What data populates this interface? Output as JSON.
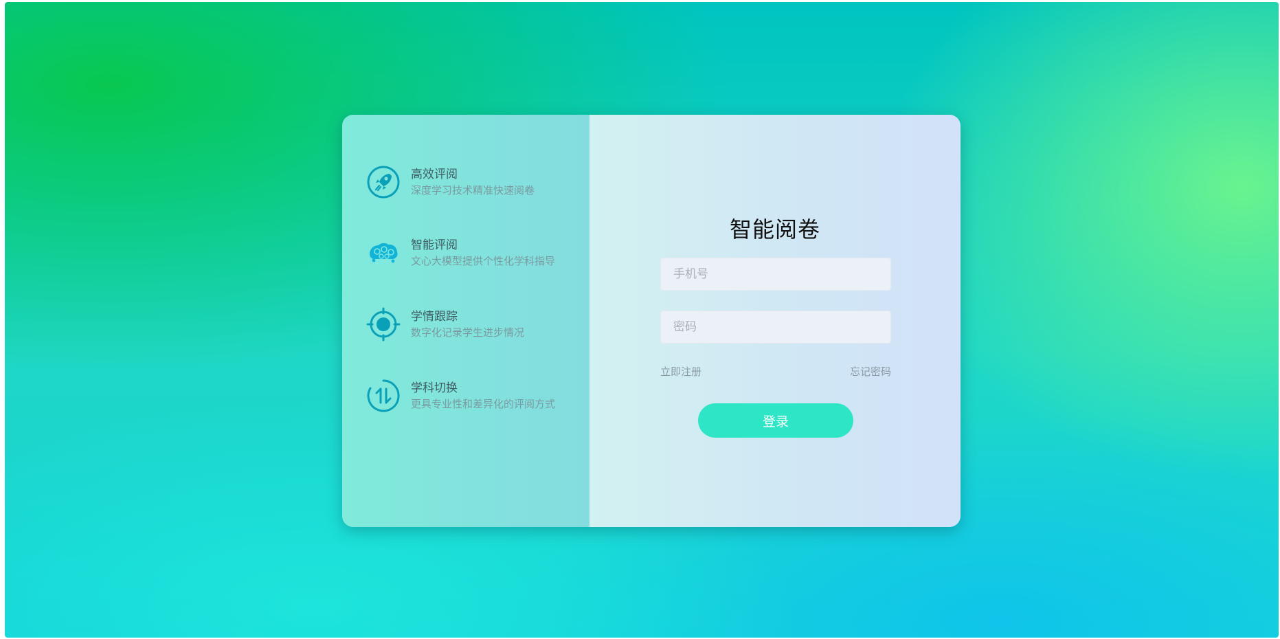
{
  "colors": {
    "accent": "#2ee6c6",
    "icon": "#0aa0b8",
    "feature_title": "#3d5c63",
    "feature_desc": "#7a9ba1"
  },
  "features": [
    {
      "icon": "rocket-icon",
      "title": "高效评阅",
      "desc": "深度学习技术精准快速阅卷"
    },
    {
      "icon": "brain-icon",
      "title": "智能评阅",
      "desc": "文心大模型提供个性化学科指导"
    },
    {
      "icon": "target-icon",
      "title": "学情跟踪",
      "desc": "数字化记录学生进步情况"
    },
    {
      "icon": "switch-icon",
      "title": "学科切换",
      "desc": "更具专业性和差异化的评阅方式"
    }
  ],
  "login": {
    "title": "智能阅卷",
    "phone_placeholder": "手机号",
    "password_placeholder": "密码",
    "register_label": "立即注册",
    "forgot_label": "忘记密码",
    "submit_label": "登录"
  }
}
